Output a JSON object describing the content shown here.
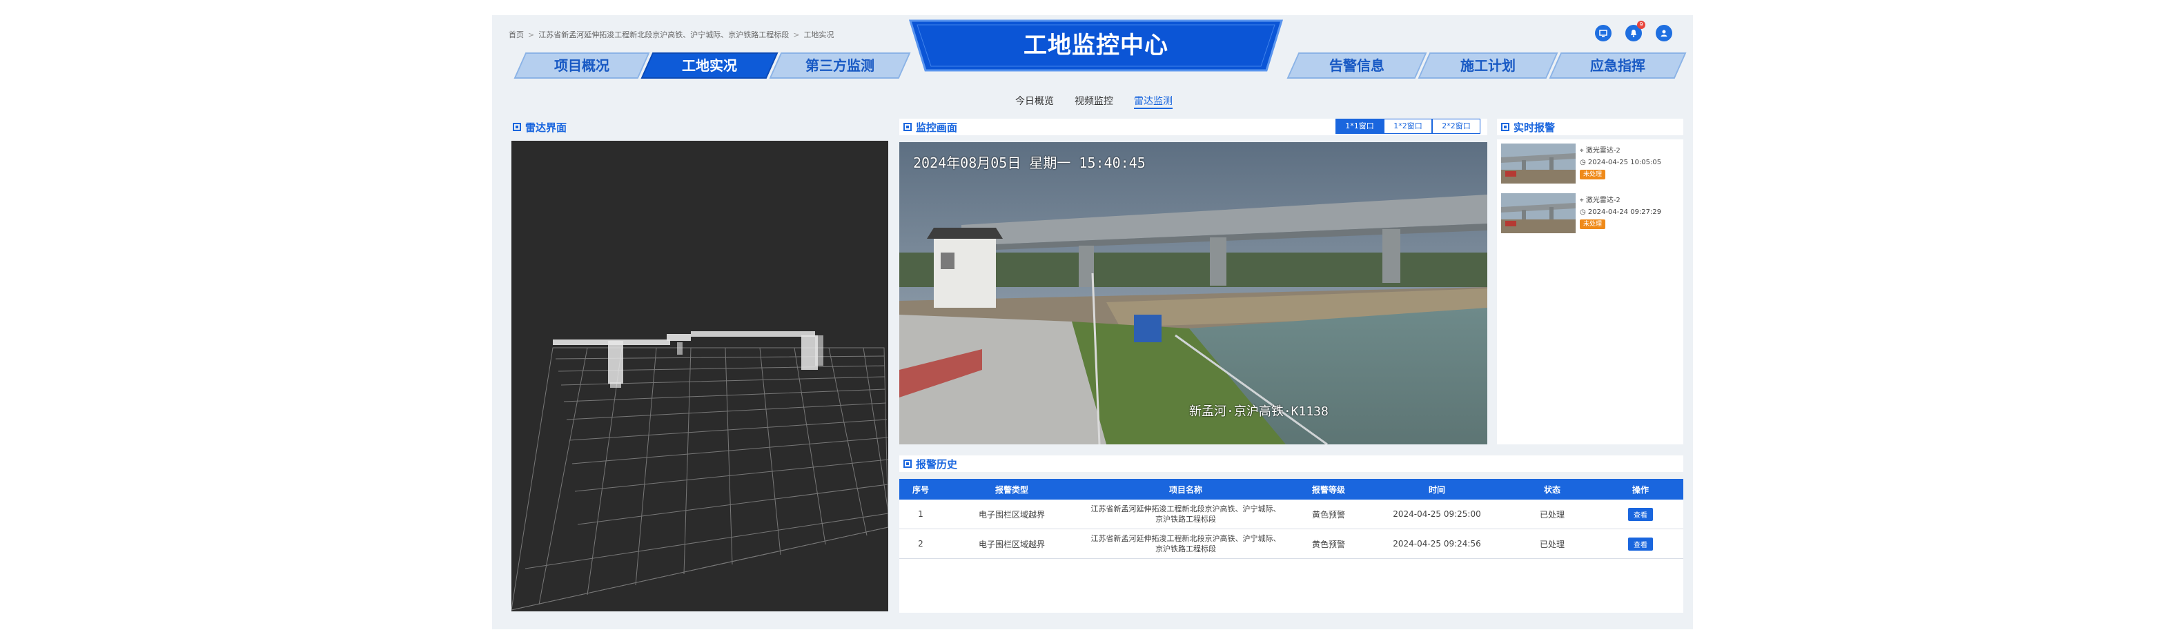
{
  "breadcrumb": [
    "首页",
    "江苏省新孟河延伸拓浚工程新北段京沪高铁、沪宁城际、京沪铁路工程标段",
    "工地实况"
  ],
  "header": {
    "title": "工地监控中心",
    "left_tabs": [
      "项目概况",
      "工地实况",
      "第三方监测"
    ],
    "right_tabs": [
      "告警信息",
      "施工计划",
      "应急指挥"
    ],
    "notification_count": "9"
  },
  "subtabs": [
    "今日概览",
    "视频监控",
    "雷达监测"
  ],
  "radar": {
    "title": "雷达界面"
  },
  "monitor": {
    "title": "监控画面",
    "window_buttons": [
      "1*1窗口",
      "1*2窗口",
      "2*2窗口"
    ],
    "timestamp": "2024年08月05日  星期一  15:40:45",
    "location": "新孟河·京沪高铁·K1138"
  },
  "realtime_alarm": {
    "title": "实时报警",
    "items": [
      {
        "device": "激光雷达-2",
        "time": "2024-04-25 10:05:05",
        "status": "未处理"
      },
      {
        "device": "激光雷达-2",
        "time": "2024-04-24 09:27:29",
        "status": "未处理"
      }
    ]
  },
  "history": {
    "title": "报警历史",
    "columns": [
      "序号",
      "报警类型",
      "项目名称",
      "报警等级",
      "时间",
      "状态",
      "操作"
    ],
    "rows": [
      {
        "no": "1",
        "type": "电子围栏区域越界",
        "project": "江苏省新孟河延伸拓浚工程新北段京沪高铁、沪宁城际、京沪铁路工程标段",
        "level": "黄色预警",
        "time": "2024-04-25 09:25:00",
        "status": "已处理",
        "action": "查看"
      },
      {
        "no": "2",
        "type": "电子围栏区域越界",
        "project": "江苏省新孟河延伸拓浚工程新北段京沪高铁、沪宁城际、京沪铁路工程标段",
        "level": "黄色预警",
        "time": "2024-04-25 09:24:56",
        "status": "已处理",
        "action": "查看"
      }
    ]
  },
  "colors": {
    "primary": "#1a66de",
    "nav_inactive": "#b5cfef",
    "warning": "#ef8a1a",
    "radar_bg": "#2b2b2b"
  }
}
